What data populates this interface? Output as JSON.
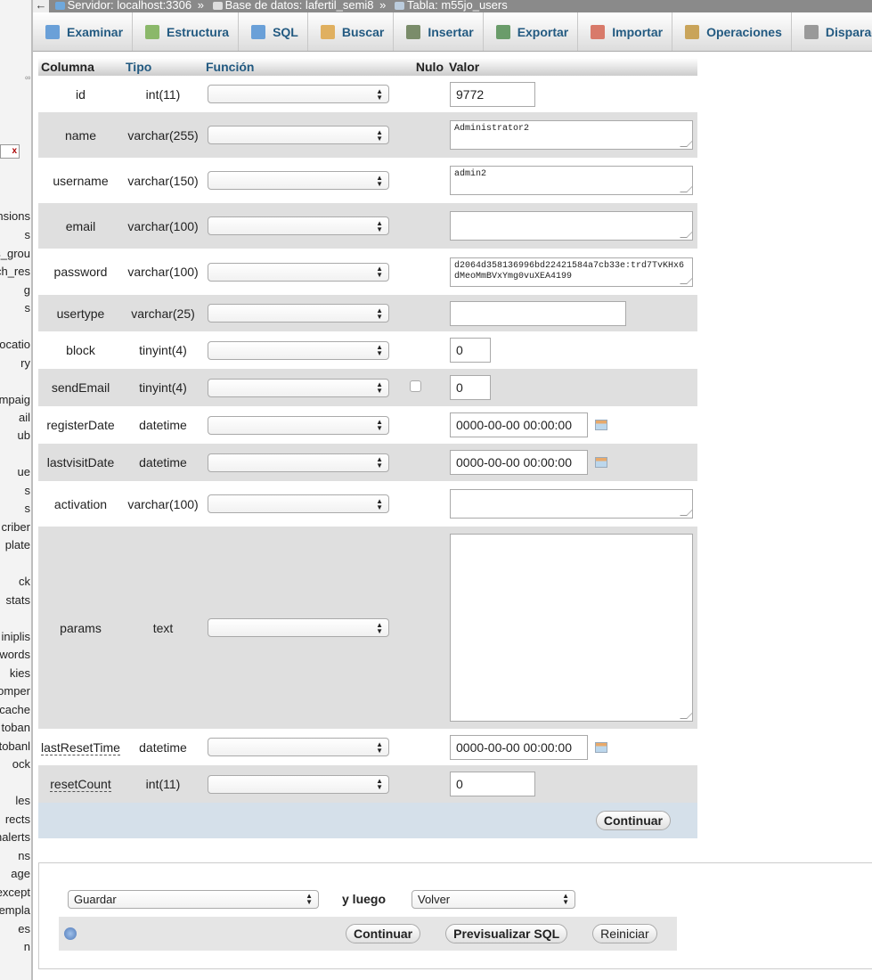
{
  "left_nav": {
    "items": [
      "nsions",
      "s",
      "s_grou",
      "ch_res",
      "g",
      "s",
      "ocatio",
      "ry",
      "ampaig",
      "ail",
      "ub",
      "ue",
      "s",
      "s",
      "criber",
      "plate",
      "ck",
      "stats",
      "iniplis",
      "words",
      "kies",
      "omper",
      "cache",
      "toban",
      "tobanl",
      "ock",
      "les",
      "rects",
      "nalerts",
      "ns",
      "age",
      "except",
      "empla",
      "es",
      "n"
    ]
  },
  "breadcrumb": {
    "back": "←",
    "server": "Servidor: localhost:3306",
    "database": "Base de datos: lafertil_semi8",
    "table": "Tabla: m55jo_users",
    "separator": "»"
  },
  "tabs": [
    {
      "label": "Examinar",
      "icon": "browse-icon"
    },
    {
      "label": "Estructura",
      "icon": "structure-icon"
    },
    {
      "label": "SQL",
      "icon": "sql-icon"
    },
    {
      "label": "Buscar",
      "icon": "search-icon"
    },
    {
      "label": "Insertar",
      "icon": "insert-icon"
    },
    {
      "label": "Exportar",
      "icon": "export-icon"
    },
    {
      "label": "Importar",
      "icon": "import-icon"
    },
    {
      "label": "Operaciones",
      "icon": "wrench-icon"
    },
    {
      "label": "Disparadores",
      "icon": "triggers-icon"
    }
  ],
  "table_headers": {
    "columna": "Columna",
    "tipo": "Tipo",
    "funcion": "Función",
    "nulo": "Nulo",
    "valor": "Valor"
  },
  "rows": [
    {
      "name": "id",
      "type": "int(11)",
      "value": "9772",
      "control": "input"
    },
    {
      "name": "name",
      "type": "varchar(255)",
      "value": "Administrator2",
      "control": "textarea"
    },
    {
      "name": "username",
      "type": "varchar(150)",
      "value": "admin2",
      "control": "textarea"
    },
    {
      "name": "email",
      "type": "varchar(100)",
      "value": "",
      "control": "textarea"
    },
    {
      "name": "password",
      "type": "varchar(100)",
      "value": "d2064d358136996bd22421584a7cb33e:trd7TvKHx6dMeoMmBVxYmg0vuXEA4199",
      "control": "textarea"
    },
    {
      "name": "usertype",
      "type": "varchar(25)",
      "value": "",
      "control": "input"
    },
    {
      "name": "block",
      "type": "tinyint(4)",
      "value": "0",
      "control": "input"
    },
    {
      "name": "sendEmail",
      "type": "tinyint(4)",
      "value": "0",
      "control": "input",
      "nullable": true
    },
    {
      "name": "registerDate",
      "type": "datetime",
      "value": "0000-00-00 00:00:00",
      "control": "date"
    },
    {
      "name": "lastvisitDate",
      "type": "datetime",
      "value": "0000-00-00 00:00:00",
      "control": "date"
    },
    {
      "name": "activation",
      "type": "varchar(100)",
      "value": "",
      "control": "textarea"
    },
    {
      "name": "params",
      "type": "text",
      "value": "",
      "control": "bigtextarea"
    },
    {
      "name": "lastResetTime",
      "type": "datetime",
      "value": "0000-00-00 00:00:00",
      "control": "date",
      "commented": true
    },
    {
      "name": "resetCount",
      "type": "int(11)",
      "value": "0",
      "control": "input",
      "commented": true
    }
  ],
  "continue_label": "Continuar",
  "bottom_form": {
    "action_select": "Guardar",
    "then_label": "y luego",
    "after_select": "Volver",
    "continue_label": "Continuar",
    "preview_label": "Previsualizar SQL",
    "reset_label": "Reiniciar"
  },
  "colors": {
    "link": "#235a81",
    "breadcrumb_bg": "#8a8a8a",
    "footer_row": "#d5e0ea"
  }
}
